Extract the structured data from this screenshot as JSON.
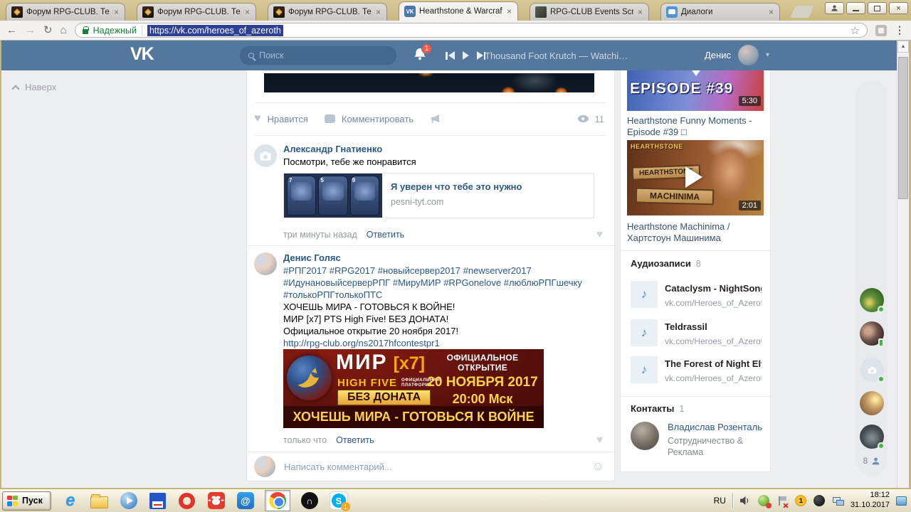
{
  "palette": {
    "vk_blue": "#54779e",
    "link_blue": "#2a5885",
    "secure_green": "#1a8038",
    "banner_red": "#570f0b",
    "banner_yellow": "#ffd24a",
    "online_green": "#4bb34b",
    "badge_red": "#f25b49"
  },
  "icons": {
    "close": "×",
    "back": "←",
    "forward": "→",
    "reload": "↻",
    "home": "⌂",
    "star": "☆",
    "menu": "⋮",
    "vk_badge": "VK",
    "note": "♪",
    "heart": "♥",
    "smiley": "☺",
    "chevron_down": "▾",
    "scroll_up": "▲",
    "ie": "e",
    "magnet": "∩",
    "skype": "S",
    "at": "@"
  },
  "browser": {
    "tabs": [
      {
        "title": "Форум RPG-CLUB. Тема: R"
      },
      {
        "title": "Форум RPG-CLUB. Тема: М"
      },
      {
        "title": "Форум RPG-CLUB. Тема: М"
      },
      {
        "title": "Hearthstone & Warcraft | H"
      },
      {
        "title": "RPG-CLUB Events Screensh"
      },
      {
        "title": "Диалоги"
      }
    ],
    "security_label": "Надежный",
    "url": "https://vk.com/heroes_of_azeroth"
  },
  "vk_header": {
    "logo": "VK",
    "search_placeholder": "Поиск",
    "notification_count": "1",
    "now_playing": "Thousand Foot Krutch — Watching ...",
    "user_name": "Денис"
  },
  "page": {
    "back_to_top": "Наверх"
  },
  "post": {
    "like_label": "Нравится",
    "comment_label": "Комментировать",
    "views": "11"
  },
  "comments": [
    {
      "author": "Александр Гнатиенко",
      "text": "Посмотри, тебе же понравится",
      "attachment": {
        "title": "Я уверен что тебе это нужно",
        "domain": "pesni-tyt.com",
        "card_costs": [
          "7",
          "5",
          "9"
        ]
      },
      "time": "три минуты назад",
      "reply_label": "Ответить"
    },
    {
      "author": "Денис Голяс",
      "hashtags": [
        "#РПГ2017 #RPG2017 #новыйсервер2017 #newserver2017",
        "#ИдунановыйсерверРПГ #МируМИР #RPGonelove #люблюРПГшечку",
        "#толькоРПГтолькоПТС"
      ],
      "lines": [
        "ХОЧЕШЬ МИРА - ГОТОВЬСЯ К ВОЙНЕ!",
        "МИР [x7] PTS High Five! БЕЗ ДОНАТА!",
        "Официальное открытие 20 ноября 2017!"
      ],
      "link": "http://rpg-club.org/ns2017hfcontestpr1",
      "time": "только что",
      "reply_label": "Ответить"
    }
  ],
  "banner": {
    "title": "МИР",
    "multiplier": "[x7]",
    "subtitle": "HIGH FIVE",
    "platform_line1": "ОФИЦИАЛЬНАЯ",
    "platform_line2": "ПЛАТФОРМА",
    "no_donate": "БЕЗ ДОНАТА",
    "opening_label": "ОФИЦИАЛЬНОЕ ОТКРЫТИЕ",
    "opening_date": "20 НОЯБРЯ 2017",
    "opening_time": "20:00 Мск",
    "slogan": "ХОЧЕШЬ МИРА - ГОТОВЬСЯ К ВОЙНЕ"
  },
  "composer": {
    "placeholder": "Написать комментарий..."
  },
  "sidebar": {
    "videos": [
      {
        "thumb_text": "EPISODE #39",
        "duration": "5:30",
        "title": "Hearthstone Funny Moments - Episode #39 □"
      },
      {
        "thumb_logo": "HEARTHSTONE",
        "sign1": "HEARTHSTONE",
        "sign2": "MACHINIMA",
        "duration": "2:01",
        "title": "Hearthstone Machinima / Хартстоун Машинима"
      }
    ],
    "audio_section": {
      "header": "Аудиозаписи",
      "count": "8",
      "items": [
        {
          "title": "Cataclysm - NightSong",
          "subtitle": "vk.com/Heroes_of_Azeroth"
        },
        {
          "title": "Teldrassil",
          "subtitle": "vk.com/Heroes_of_Azeroth"
        },
        {
          "title": "The Forest of Night Elves",
          "subtitle": "vk.com/Heroes_of_Azeroth"
        }
      ]
    },
    "contacts_section": {
      "header": "Контакты",
      "count": "1",
      "contact": {
        "name": "Владислав Розенталь",
        "role": "Сотрудничество & Реклама"
      }
    }
  },
  "friends_bar": {
    "online_count": "8"
  },
  "taskbar": {
    "start_label": "Пуск",
    "lang": "RU",
    "time": "18:12",
    "date": "31.10.2017",
    "skype_badge": "1",
    "alert_badge": "1"
  }
}
